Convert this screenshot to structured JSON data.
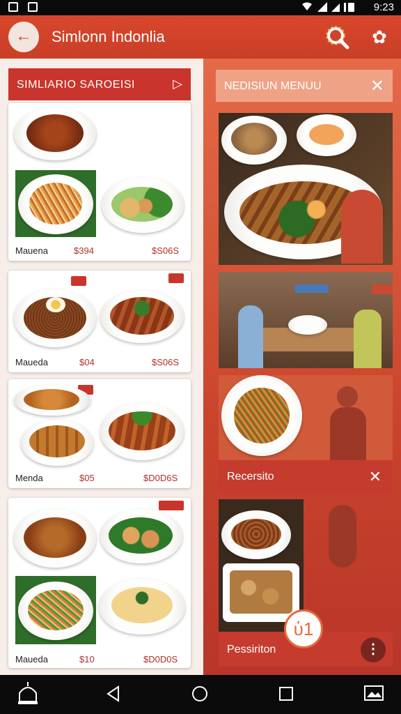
{
  "status_bar": {
    "time": "9:23"
  },
  "app_bar": {
    "title": "Simlonn Indonlia",
    "back_icon": "arrow-left-icon",
    "search_icon": "search-icon",
    "settings_icon": "gear-icon"
  },
  "left": {
    "header": "SIMLIARIO SAROEISI",
    "cards": [
      {
        "name": "Mauena",
        "price_left": "$394",
        "price_right": "$S06S"
      },
      {
        "name": "Maueda",
        "price_left": "$04",
        "price_right": "$S06S"
      },
      {
        "name": "Menda",
        "price_left": "$05",
        "price_right": "$D0D6S"
      },
      {
        "name": "Maueda",
        "price_left": "$10",
        "price_right": "$D0D0S"
      }
    ]
  },
  "right": {
    "header": "NEDISIUN MENUU",
    "banner1": "Recersito",
    "banner2": "Pessiriton"
  },
  "colors": {
    "accent": "#c9342c",
    "appbar": "#d8472c",
    "panel_bg": "#f7eee9",
    "fab_ring": "#e66a3a"
  }
}
